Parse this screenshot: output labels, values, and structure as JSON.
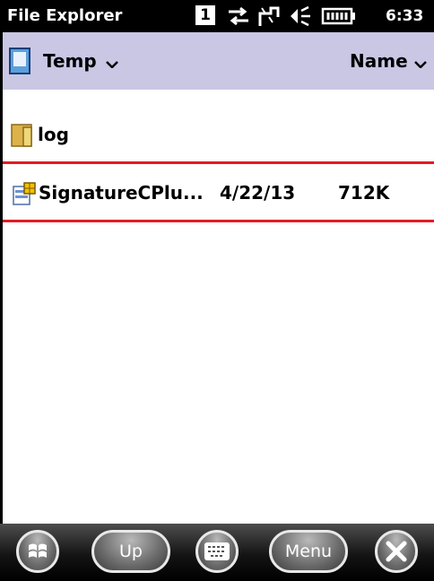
{
  "status": {
    "title": "File Explorer",
    "notification_count": "1",
    "time": "6:33"
  },
  "header": {
    "folder": "Temp",
    "sort_by": "Name"
  },
  "files": [
    {
      "name": "log",
      "date": "",
      "size": "",
      "type": "folder"
    },
    {
      "name": "SignatureCPlu...",
      "date": "4/22/13",
      "size": "712K",
      "type": "installer",
      "highlighted": true
    }
  ],
  "taskbar": {
    "up_label": "Up",
    "menu_label": "Menu"
  },
  "colors": {
    "header_bg": "#c9c7e4",
    "highlight_border": "#e51a22",
    "status_bg": "#000000"
  },
  "icons": [
    "document-icon",
    "folder-icon",
    "installer-icon",
    "windows-start-icon",
    "keyboard-icon",
    "close-icon",
    "speaker-icon",
    "battery-icon",
    "sync-arrows-icon",
    "signal-icon"
  ]
}
